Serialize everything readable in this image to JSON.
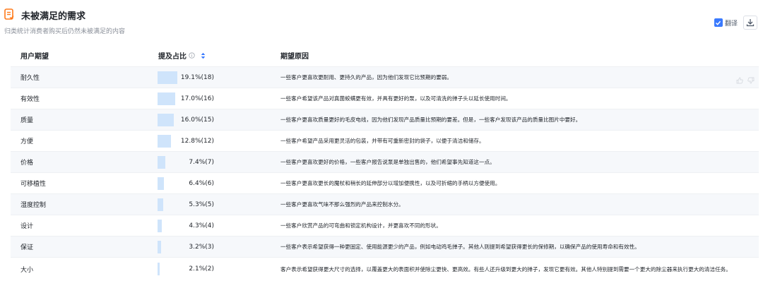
{
  "header": {
    "title": "未被满足的需求",
    "subtitle": "归类统计消费者购买后仍然未被满足的内容",
    "title_icon": "document-icon",
    "accent_color": "#ff7a1a"
  },
  "tools": {
    "translate_label": "翻译",
    "translate_checked": true,
    "download_icon": "download-icon",
    "checkbox_color": "#3a7afe"
  },
  "table": {
    "columns": {
      "expectation": "用户期望",
      "share": "提及占比",
      "reason": "期望原因"
    },
    "bar_color": "#cfe4fb",
    "rows": [
      {
        "name": "耐久性",
        "pct": "19.1%(18)",
        "value": 19.1,
        "reason": "一些客户更喜欢更耐用、更持久的产品，因为他们发现它比预期的要弱。"
      },
      {
        "name": "有效性",
        "pct": "17.0%(16)",
        "value": 17.0,
        "reason": "一些客户希望该产品对真菌蛟螨更有效，并具有更好的泵，以及可清洗的掸子头以延长使用时间。"
      },
      {
        "name": "质量",
        "pct": "16.0%(15)",
        "value": 16.0,
        "reason": "一些客户更喜欢质量更好的毛皮电线，因为他们发现产品质量比预期的要差。但是，一些客户发现该产品的质量比图片中要好。"
      },
      {
        "name": "方便",
        "pct": "12.8%(12)",
        "value": 12.8,
        "reason": "一些客户希望产品采用更灵活的包装，并带有可重新密封的袋子，以便于清洁和储存。"
      },
      {
        "name": "价格",
        "pct": "7.4%(7)",
        "value": 7.4,
        "reason": "一些客户更喜欢更好的价格，一些客户报告说泵是单独出售的，他们希望事先知道这一点。"
      },
      {
        "name": "可移植性",
        "pct": "6.4%(6)",
        "value": 6.4,
        "reason": "一些客户更喜欢更长的魔杖和稍长的延伸部分以增加便携性，以及可折缩的手柄以方便使用。"
      },
      {
        "name": "湿度控制",
        "pct": "5.3%(5)",
        "value": 5.3,
        "reason": "一些客户更喜欢气味不那么强烈的产品来控制水分。"
      },
      {
        "name": "设计",
        "pct": "4.3%(4)",
        "value": 4.3,
        "reason": "一些客户欣赏产品的可弯曲和锁定机构设计，并更喜欢不同的形状。"
      },
      {
        "name": "保证",
        "pct": "3.2%(3)",
        "value": 3.2,
        "reason": "一些客户表示希望获得一种更固定、使用能源更少的产品，例如电动鸡毛掸子。其他人则提到希望获得更长的保修期，以确保产品的使用寿命和有效性。"
      },
      {
        "name": "大小",
        "pct": "2.1%(2)",
        "value": 2.1,
        "reason": "客户表示希望获得更大尺寸的选择，以覆盖更大的表面积并使除尘更快、更高效。有些人还升级到更大的掸子，发现它更有效。其他人特别提到需要一个更大的除尘器来执行更大的清洁任务。"
      }
    ]
  }
}
